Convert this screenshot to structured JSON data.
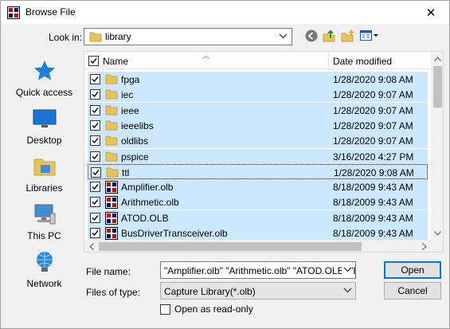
{
  "window": {
    "title": "Browse File",
    "close_glyph": "✕"
  },
  "look_in": {
    "label": "Look in:",
    "value": "library"
  },
  "toolbar": [
    {
      "name": "back-icon"
    },
    {
      "name": "up-folder-icon"
    },
    {
      "name": "new-folder-icon"
    },
    {
      "name": "view-menu-icon"
    }
  ],
  "places": [
    {
      "name": "place-quick-access",
      "icon": "star-icon",
      "label": "Quick access"
    },
    {
      "name": "place-desktop",
      "icon": "desktop-icon",
      "label": "Desktop"
    },
    {
      "name": "place-libraries",
      "icon": "libraries-icon",
      "label": "Libraries"
    },
    {
      "name": "place-this-pc",
      "icon": "computer-icon",
      "label": "This PC"
    },
    {
      "name": "place-network",
      "icon": "network-icon",
      "label": "Network"
    }
  ],
  "file_list": {
    "columns": {
      "name": "Name",
      "date": "Date modified"
    },
    "rows": [
      {
        "type": "folder",
        "name": "fpga",
        "date": "1/28/2020 9:08 AM"
      },
      {
        "type": "folder",
        "name": "iec",
        "date": "1/28/2020 9:07 AM"
      },
      {
        "type": "folder",
        "name": "ieee",
        "date": "1/28/2020 9:07 AM"
      },
      {
        "type": "folder",
        "name": "ieeelibs",
        "date": "1/28/2020 9:07 AM"
      },
      {
        "type": "folder",
        "name": "oldlibs",
        "date": "1/28/2020 9:07 AM"
      },
      {
        "type": "folder",
        "name": "pspice",
        "date": "3/16/2020 4:27 PM"
      },
      {
        "type": "folder",
        "name": "ttl",
        "date": "1/28/2020 9:08 AM"
      },
      {
        "type": "olb",
        "name": "Amplifier.olb",
        "date": "8/18/2009 9:43 AM"
      },
      {
        "type": "olb",
        "name": "Arithmetic.olb",
        "date": "8/18/2009 9:43 AM"
      },
      {
        "type": "olb",
        "name": "ATOD.OLB",
        "date": "8/18/2009 9:43 AM"
      },
      {
        "type": "olb",
        "name": "BusDriverTransceiver.olb",
        "date": "8/18/2009 9:43 AM"
      }
    ]
  },
  "file_name": {
    "label": "File name:",
    "value": "\"Amplifier.olb\" \"Arithmetic.olb\" \"ATOD.OLB\" \"B"
  },
  "files_of_type": {
    "label": "Files of type:",
    "value": "Capture Library(*.olb)"
  },
  "read_only": {
    "label": "Open as read-only"
  },
  "buttons": {
    "open": "Open",
    "cancel": "Cancel"
  },
  "colors": {
    "selection": "#cce8ff",
    "accent": "#0078d7",
    "folder": "#e8c25e"
  }
}
